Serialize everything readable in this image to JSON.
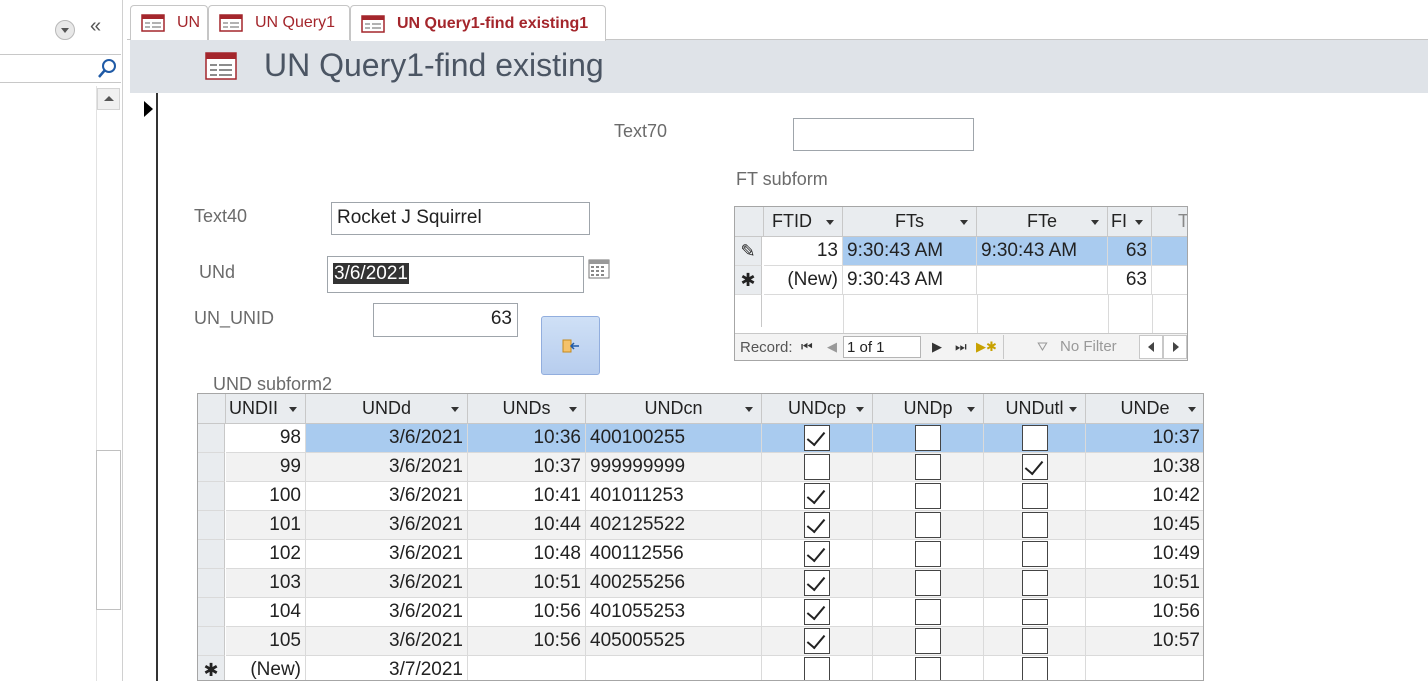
{
  "tabs": [
    {
      "label": "UN",
      "active": false
    },
    {
      "label": "UN Query1",
      "active": false
    },
    {
      "label": "UN Query1-find existing1",
      "active": true
    }
  ],
  "form": {
    "title": "UN Query1-find existing",
    "text70_label": "Text70",
    "text70_value": "",
    "text40_label": "Text40",
    "text40_value": "Rocket J Squirrel",
    "und_label": "UNd",
    "und_value": "3/6/2021",
    "un_unid_label": "UN_UNID",
    "un_unid_value": "63",
    "ft_subform_label": "FT subform",
    "und_subform_label": "UND subform2"
  },
  "ft_subform": {
    "columns": [
      "FTID",
      "FTs",
      "FTe",
      "FІ",
      "T"
    ],
    "rows": [
      {
        "selector": "✎",
        "FTID": "13",
        "FTs": "9:30:43 AM",
        "FTe": "9:30:43 AM",
        "F": "63"
      },
      {
        "selector": "✱",
        "FTID": "(New)",
        "FTs": "9:30:43 AM",
        "FTe": "",
        "F": "63"
      }
    ],
    "nav": {
      "record_label": "Record:",
      "position": "1 of 1",
      "filter_label": "No Filter"
    }
  },
  "und_subform": {
    "columns": [
      "UNDII",
      "UNDd",
      "UNDs",
      "UNDcn",
      "UNDcp",
      "UNDp",
      "UNDutl",
      "UNDe"
    ],
    "rows": [
      {
        "id": "98",
        "d": "3/6/2021",
        "s": "10:36",
        "cn": "400100255",
        "cp": true,
        "p": false,
        "utl": false,
        "e": "10:37"
      },
      {
        "id": "99",
        "d": "3/6/2021",
        "s": "10:37",
        "cn": "999999999",
        "cp": false,
        "p": false,
        "utl": true,
        "e": "10:38"
      },
      {
        "id": "100",
        "d": "3/6/2021",
        "s": "10:41",
        "cn": "401011253",
        "cp": true,
        "p": false,
        "utl": false,
        "e": "10:42"
      },
      {
        "id": "101",
        "d": "3/6/2021",
        "s": "10:44",
        "cn": "402125522",
        "cp": true,
        "p": false,
        "utl": false,
        "e": "10:45"
      },
      {
        "id": "102",
        "d": "3/6/2021",
        "s": "10:48",
        "cn": "400112556",
        "cp": true,
        "p": false,
        "utl": false,
        "e": "10:49"
      },
      {
        "id": "103",
        "d": "3/6/2021",
        "s": "10:51",
        "cn": "400255256",
        "cp": true,
        "p": false,
        "utl": false,
        "e": "10:51"
      },
      {
        "id": "104",
        "d": "3/6/2021",
        "s": "10:56",
        "cn": "401055253",
        "cp": true,
        "p": false,
        "utl": false,
        "e": "10:56"
      },
      {
        "id": "105",
        "d": "3/6/2021",
        "s": "10:56",
        "cn": "405005525",
        "cp": true,
        "p": false,
        "utl": false,
        "e": "10:57"
      }
    ],
    "new_row": {
      "id": "(New)",
      "d": "3/7/2021",
      "selector": "✱"
    }
  },
  "colors": {
    "accent": "#a4262c",
    "header_band": "#dfe3e8",
    "selected_row": "#a9cbef"
  }
}
